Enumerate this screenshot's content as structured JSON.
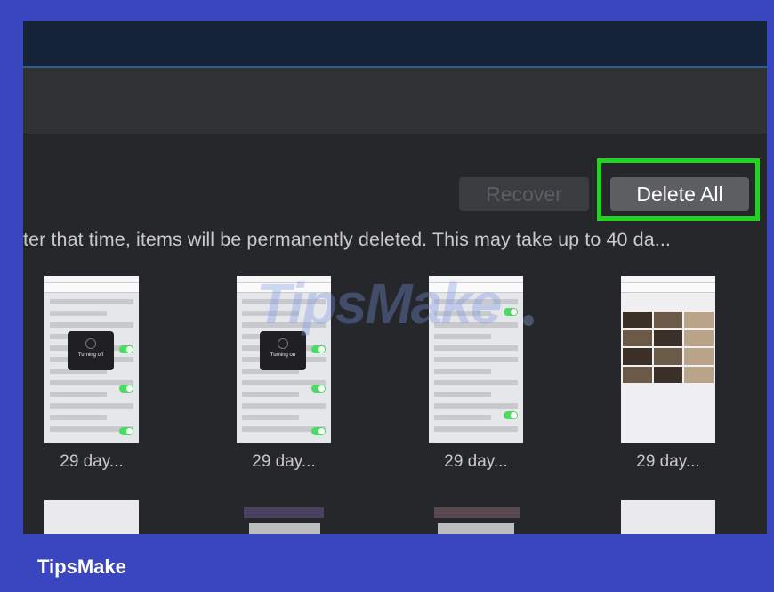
{
  "recover_label": "Recover",
  "delete_all_label": "Delete All",
  "info_text": "ter that time, items will be permanently deleted. This may take up to 40 da...",
  "thumbnails": [
    {
      "days": "29 day...",
      "hud": "Turning off"
    },
    {
      "days": "29 day...",
      "hud": "Turning on"
    },
    {
      "days": "29 day..."
    },
    {
      "days": "29 day..."
    }
  ],
  "watermark": "TipsMake",
  "footer": "TipsMake",
  "colors": {
    "highlight": "#21d421",
    "background": "#3a46c0"
  }
}
